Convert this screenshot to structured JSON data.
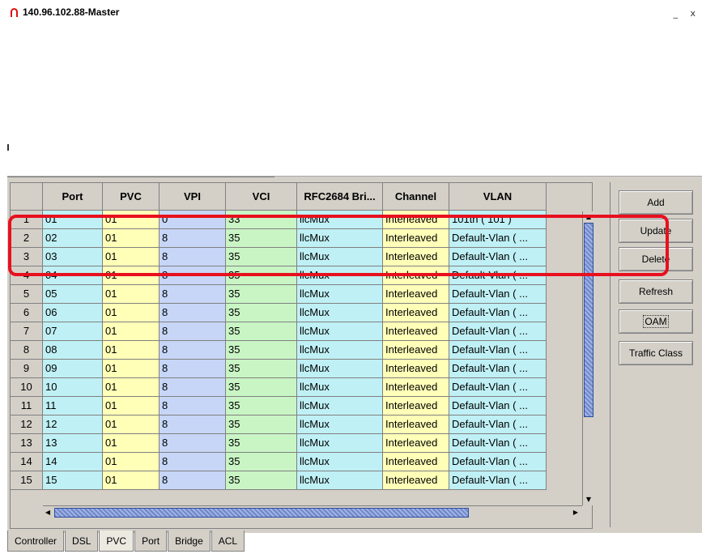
{
  "window": {
    "title": "140.96.102.88-Master",
    "controls": "_ x"
  },
  "table": {
    "headers": [
      "",
      "Port",
      "PVC",
      "VPI",
      "VCI",
      "RFC2684 Bri...",
      "Channel",
      "VLAN"
    ],
    "rows": [
      [
        "1",
        "01",
        "01",
        "0",
        "33",
        "llcMux",
        "Interleaved",
        "101th ( 101 )"
      ],
      [
        "2",
        "02",
        "01",
        "8",
        "35",
        "llcMux",
        "Interleaved",
        "Default-Vlan ( ..."
      ],
      [
        "3",
        "03",
        "01",
        "8",
        "35",
        "llcMux",
        "Interleaved",
        "Default-Vlan ( ..."
      ],
      [
        "4",
        "04",
        "01",
        "8",
        "35",
        "llcMux",
        "Interleaved",
        "Default-Vlan ( ..."
      ],
      [
        "5",
        "05",
        "01",
        "8",
        "35",
        "llcMux",
        "Interleaved",
        "Default-Vlan ( ..."
      ],
      [
        "6",
        "06",
        "01",
        "8",
        "35",
        "llcMux",
        "Interleaved",
        "Default-Vlan ( ..."
      ],
      [
        "7",
        "07",
        "01",
        "8",
        "35",
        "llcMux",
        "Interleaved",
        "Default-Vlan ( ..."
      ],
      [
        "8",
        "08",
        "01",
        "8",
        "35",
        "llcMux",
        "Interleaved",
        "Default-Vlan ( ..."
      ],
      [
        "9",
        "09",
        "01",
        "8",
        "35",
        "llcMux",
        "Interleaved",
        "Default-Vlan ( ..."
      ],
      [
        "10",
        "10",
        "01",
        "8",
        "35",
        "llcMux",
        "Interleaved",
        "Default-Vlan ( ..."
      ],
      [
        "11",
        "11",
        "01",
        "8",
        "35",
        "llcMux",
        "Interleaved",
        "Default-Vlan ( ..."
      ],
      [
        "12",
        "12",
        "01",
        "8",
        "35",
        "llcMux",
        "Interleaved",
        "Default-Vlan ( ..."
      ],
      [
        "13",
        "13",
        "01",
        "8",
        "35",
        "llcMux",
        "Interleaved",
        "Default-Vlan ( ..."
      ],
      [
        "14",
        "14",
        "01",
        "8",
        "35",
        "llcMux",
        "Interleaved",
        "Default-Vlan ( ..."
      ],
      [
        "15",
        "15",
        "01",
        "8",
        "35",
        "llcMux",
        "Interleaved",
        "Default-Vlan ( ..."
      ]
    ]
  },
  "buttons": [
    "Add",
    "Update",
    "Delete",
    "Refresh",
    "OAM",
    "Traffic Class"
  ],
  "tabs": [
    "Controller",
    "DSL",
    "PVC",
    "Port",
    "Bridge",
    "ACL"
  ],
  "active_tab": "PVC",
  "colors": {
    "highlight_box": "#e8101e",
    "port": "#bff0f5",
    "pvc": "#ffffb8",
    "vpi": "#c7d6f7",
    "vci": "#c9f5c4",
    "panel": "#d4d0c8",
    "scroll_thumb": "#6f87c9"
  },
  "icons": {
    "title": "app-logo-icon",
    "scroll_up": "arrow-up-icon",
    "scroll_down": "arrow-down-icon",
    "scroll_left": "arrow-left-icon",
    "scroll_right": "arrow-right-icon"
  }
}
